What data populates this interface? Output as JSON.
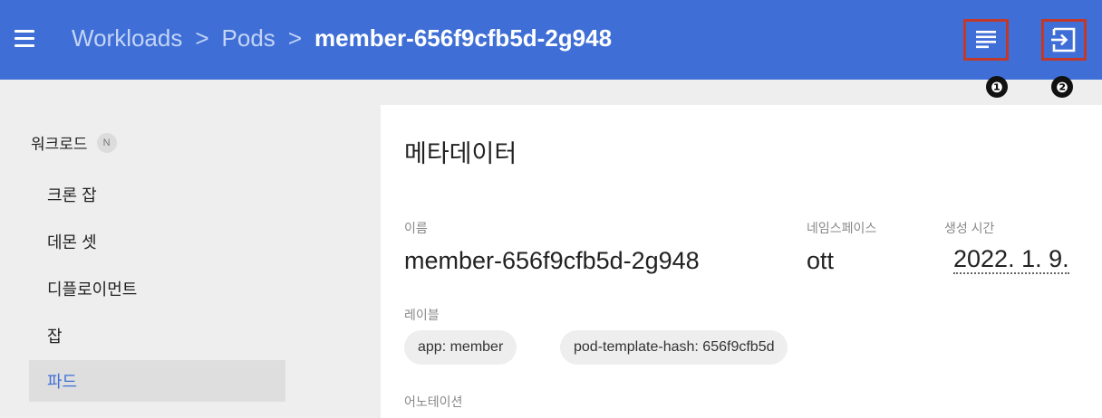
{
  "header": {
    "breadcrumbs": [
      "Workloads",
      "Pods"
    ],
    "separator": ">",
    "current": "member-656f9cfb5d-2g948",
    "callouts": [
      "❶",
      "❷"
    ],
    "icons": [
      "menu-icon",
      "logs-icon",
      "exec-shell-icon"
    ],
    "accent_color": "#3f6fd6",
    "highlight_color": "#c0392b"
  },
  "sidebar": {
    "section_title": "워크로드",
    "section_badge": "N",
    "items": [
      {
        "label": "크론 잡"
      },
      {
        "label": "데몬 셋"
      },
      {
        "label": "디플로이먼트"
      },
      {
        "label": "잡"
      },
      {
        "label": "파드",
        "active": true
      }
    ]
  },
  "metadata": {
    "title": "메타데이터",
    "name_label": "이름",
    "name_value": "member-656f9cfb5d-2g948",
    "namespace_label": "네임스페이스",
    "namespace_value": "ott",
    "created_label": "생성 시간",
    "created_value": "2022. 1. 9.",
    "labels_label": "레이블",
    "labels": [
      "app: member",
      "pod-template-hash: 656f9cfb5d"
    ],
    "annotations_label": "어노테이션"
  }
}
